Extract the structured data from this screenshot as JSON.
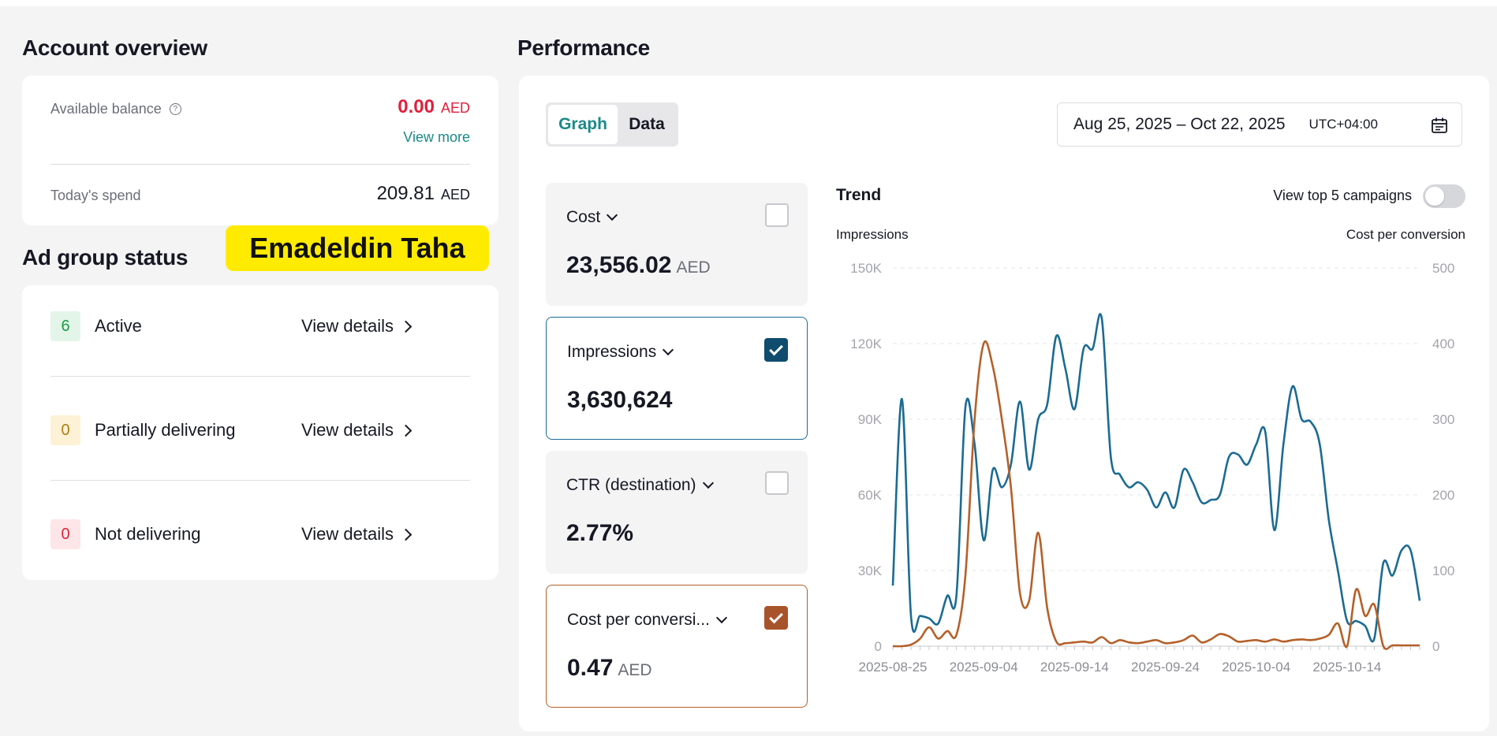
{
  "account_overview": {
    "title": "Account overview",
    "available_balance_label": "Available balance",
    "available_balance_value": "0.00",
    "available_balance_currency": "AED",
    "view_more": "View more",
    "todays_spend_label": "Today's spend",
    "todays_spend_value": "209.81",
    "todays_spend_currency": "AED"
  },
  "ad_group_status": {
    "title": "Ad group status",
    "rows": [
      {
        "count": "6",
        "label": "Active",
        "action": "View details",
        "color": "#1a9b47",
        "bg": "#e3f5e8"
      },
      {
        "count": "0",
        "label": "Partially delivering",
        "action": "View details",
        "color": "#b07d12",
        "bg": "#fdf1d6"
      },
      {
        "count": "0",
        "label": "Not delivering",
        "action": "View details",
        "color": "#d6283c",
        "bg": "#fde5e8"
      }
    ]
  },
  "watermark": {
    "text": "Emadeldin Taha",
    "bg": "#ffeb00"
  },
  "performance": {
    "title": "Performance",
    "tabs": [
      {
        "label": "Graph",
        "active": true
      },
      {
        "label": "Data",
        "active": false
      }
    ],
    "date_range": "Aug 25, 2025 – Oct 22, 2025",
    "timezone": "UTC+04:00",
    "metrics": [
      {
        "name": "Cost",
        "value": "23,556.02",
        "unit": "AED",
        "checked": false
      },
      {
        "name": "Impressions",
        "value": "3,630,624",
        "unit": "",
        "checked": true,
        "color": "#0f4c6e"
      },
      {
        "name": "CTR (destination)",
        "value": "2.77%",
        "unit": "",
        "checked": false
      },
      {
        "name": "Cost per conversi...",
        "value": "0.47",
        "unit": "AED",
        "checked": true,
        "color": "#a8542a"
      }
    ],
    "trend": {
      "title": "Trend",
      "toggle_label": "View top 5 campaigns",
      "toggle_on": false,
      "left_axis_title": "Impressions",
      "right_axis_title": "Cost per conversion"
    }
  },
  "chart_data": {
    "type": "line",
    "title": "Trend",
    "xlabel": "",
    "ylabel": "Impressions",
    "y2label": "Cost per conversion",
    "ylim": [
      0,
      150000
    ],
    "y2lim": [
      0,
      500
    ],
    "y_ticks": [
      "0",
      "30K",
      "60K",
      "90K",
      "120K",
      "150K"
    ],
    "y2_ticks": [
      "0",
      "100",
      "200",
      "300",
      "400",
      "500"
    ],
    "x_ticks": [
      "2025-08-25",
      "2025-09-04",
      "2025-09-14",
      "2025-09-24",
      "2025-10-04",
      "2025-10-14"
    ],
    "x_start": "2025-08-25",
    "x_end": "2025-10-22",
    "grid": true,
    "series": [
      {
        "name": "Impressions",
        "axis": "left",
        "color": "#1b6b93",
        "values": [
          24000,
          98000,
          12000,
          12000,
          11000,
          9000,
          20000,
          20000,
          95000,
          80000,
          42000,
          70000,
          63000,
          72000,
          97000,
          70000,
          90000,
          96000,
          123000,
          110000,
          94000,
          118000,
          118000,
          130000,
          75000,
          68000,
          63000,
          65000,
          62000,
          55000,
          61000,
          55000,
          70000,
          65000,
          57000,
          58000,
          60000,
          75000,
          76000,
          72000,
          80000,
          85000,
          46000,
          80000,
          103000,
          90000,
          89000,
          80000,
          50000,
          30000,
          10000,
          10000,
          8000,
          3000,
          33000,
          28000,
          38000,
          38000,
          18000
        ]
      },
      {
        "name": "Cost per conversion",
        "axis": "right",
        "color": "#b5602a",
        "values": [
          0,
          0,
          2,
          10,
          25,
          10,
          20,
          15,
          95,
          300,
          400,
          370,
          300,
          210,
          70,
          60,
          150,
          50,
          6,
          4,
          5,
          6,
          5,
          12,
          4,
          8,
          5,
          4,
          6,
          8,
          4,
          5,
          8,
          14,
          5,
          9,
          16,
          13,
          6,
          7,
          8,
          6,
          9,
          6,
          8,
          9,
          8,
          10,
          15,
          30,
          0,
          75,
          40,
          55,
          0,
          1,
          1,
          1,
          1
        ]
      }
    ]
  }
}
